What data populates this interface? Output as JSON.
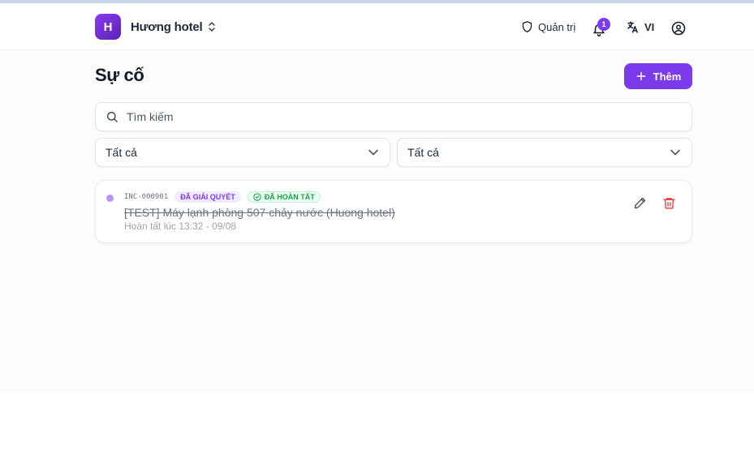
{
  "header": {
    "logo_letter": "H",
    "hotel_name": "Hương hotel",
    "admin_label": "Quản trị",
    "notification_count": "1",
    "language_label": "VI"
  },
  "page": {
    "title": "Sự cố",
    "add_label": "Thêm"
  },
  "search": {
    "placeholder": "Tìm kiếm",
    "value": ""
  },
  "filters": [
    {
      "selected": "Tất cả"
    },
    {
      "selected": "Tất cả"
    }
  ],
  "incidents": [
    {
      "code": "INC-000901",
      "status_badge": "ĐÃ GIẢI QUYẾT",
      "completion_badge": "ĐÃ HOÀN TẤT",
      "title": "[TEST] Máy lạnh phòng 507 chảy nước (Huong hotel)",
      "completed_text": "Hoàn tất lúc 13:32 - 09/08"
    }
  ],
  "icons": {
    "admin": "shield-icon",
    "notifications": "bell-icon",
    "language": "translate-icon",
    "account": "user-circle-icon",
    "add": "plus-icon",
    "search": "search-icon",
    "select": "chevron-down-icon",
    "completed": "check-circle-icon",
    "edit": "pencil-icon",
    "delete": "trash-icon"
  },
  "colors": {
    "accent": "#7c3aed",
    "status_dot": "#b794f4",
    "success": "#16a34a",
    "danger": "#ef4444"
  }
}
